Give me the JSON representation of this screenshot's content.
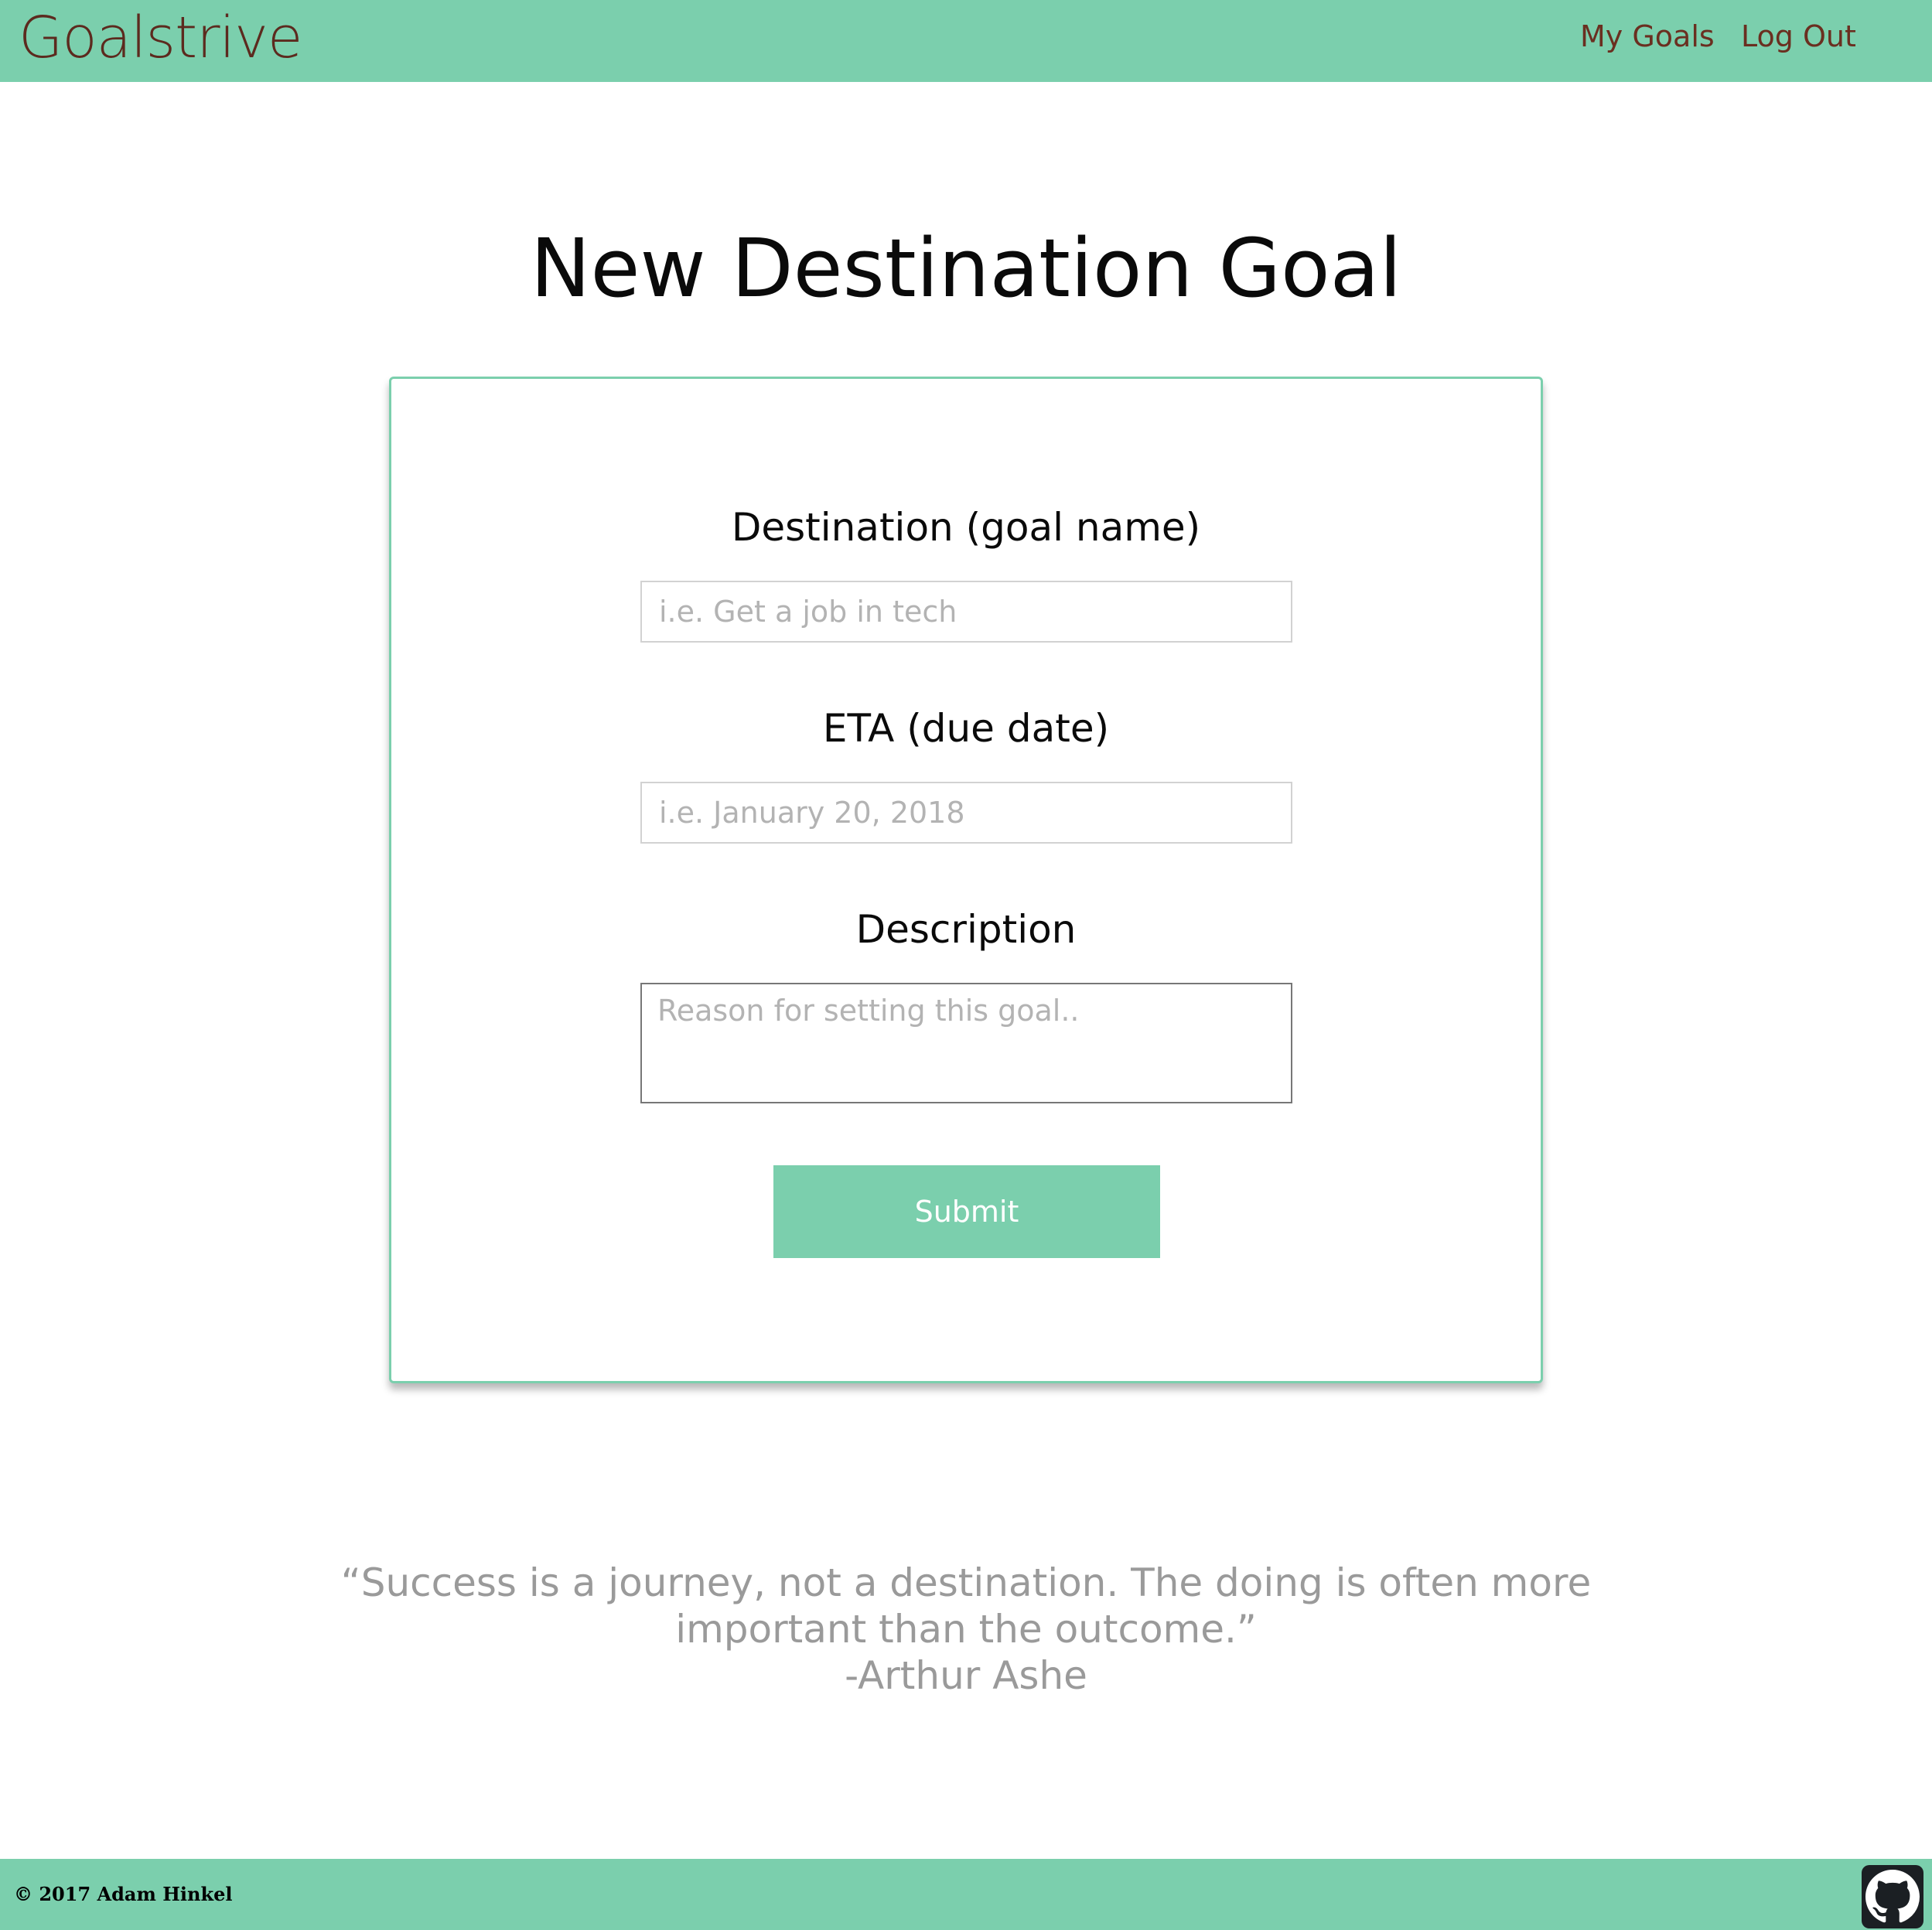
{
  "header": {
    "brand": "Goalstrive",
    "nav": {
      "my_goals": "My Goals",
      "log_out": "Log Out"
    }
  },
  "main": {
    "title": "New Destination Goal",
    "form": {
      "destination": {
        "label": "Destination (goal name)",
        "placeholder": "i.e. Get a job in tech",
        "value": ""
      },
      "eta": {
        "label": "ETA (due date)",
        "placeholder": "i.e. January 20, 2018",
        "value": ""
      },
      "description": {
        "label": "Description",
        "placeholder": "Reason for setting this goal..",
        "value": ""
      },
      "submit_label": "Submit"
    }
  },
  "quote": {
    "line1": "“Success is a journey, not a destination. The doing is often more",
    "line2": "important than the outcome.”",
    "author": "-Arthur Ashe"
  },
  "footer": {
    "copyright": "© 2017 Adam Hinkel",
    "github_icon": "github-icon"
  },
  "colors": {
    "accent": "#7bcfad",
    "brand_text": "#5c2a1e",
    "quote_text": "#9a9a9a"
  }
}
